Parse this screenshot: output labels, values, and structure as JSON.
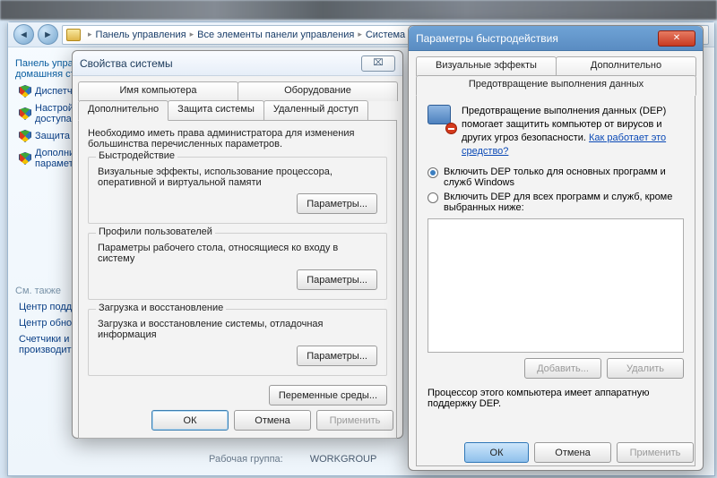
{
  "breadcrumb": {
    "item1": "Панель управления",
    "item2": "Все элементы панели управления",
    "item3": "Система"
  },
  "sidebar": {
    "head1": "Панель управления -",
    "head2": "домашняя страница",
    "items": [
      "Диспетчер устройств",
      "Настройка удаленного доступа",
      "Защита системы",
      "Дополнительные параметры системы"
    ],
    "seealso": "См. также",
    "links": [
      "Центр поддержки",
      "Центр обновления Windows",
      "Счетчики и средства производительности"
    ]
  },
  "footer": {
    "label": "Рабочая группа:",
    "value": "WORKGROUP"
  },
  "sysprops": {
    "title": "Свойства системы",
    "close_glyph": "⌧",
    "tabs_row1": [
      "Имя компьютера",
      "Оборудование"
    ],
    "tabs_row2": [
      "Дополнительно",
      "Защита системы",
      "Удаленный доступ"
    ],
    "note": "Необходимо иметь права администратора для изменения большинства перечисленных параметров.",
    "groups": {
      "perf": {
        "title": "Быстродействие",
        "desc": "Визуальные эффекты, использование процессора, оперативной и виртуальной памяти",
        "btn": "Параметры..."
      },
      "profiles": {
        "title": "Профили пользователей",
        "desc": "Параметры рабочего стола, относящиеся ко входу в систему",
        "btn": "Параметры..."
      },
      "startup": {
        "title": "Загрузка и восстановление",
        "desc": "Загрузка и восстановление системы, отладочная информация",
        "btn": "Параметры..."
      }
    },
    "env_btn": "Переменные среды...",
    "ok": "ОК",
    "cancel": "Отмена",
    "apply": "Применить"
  },
  "perfopts": {
    "title": "Параметры быстродействия",
    "tabs_row1": [
      "Визуальные эффекты",
      "Дополнительно"
    ],
    "tab_active": "Предотвращение выполнения данных",
    "dep_desc": "Предотвращение выполнения данных (DEP) помогает защитить компьютер от вирусов и других угроз безопасности. ",
    "dep_link": "Как работает это средство?",
    "radio1": "Включить DEP только для основных программ и служб Windows",
    "radio2": "Включить DEP для всех программ и служб, кроме выбранных ниже:",
    "add_btn": "Добавить...",
    "del_btn": "Удалить",
    "hw_note": "Процессор этого компьютера имеет аппаратную поддержку DEP.",
    "ok": "ОК",
    "cancel": "Отмена",
    "apply": "Применить"
  }
}
